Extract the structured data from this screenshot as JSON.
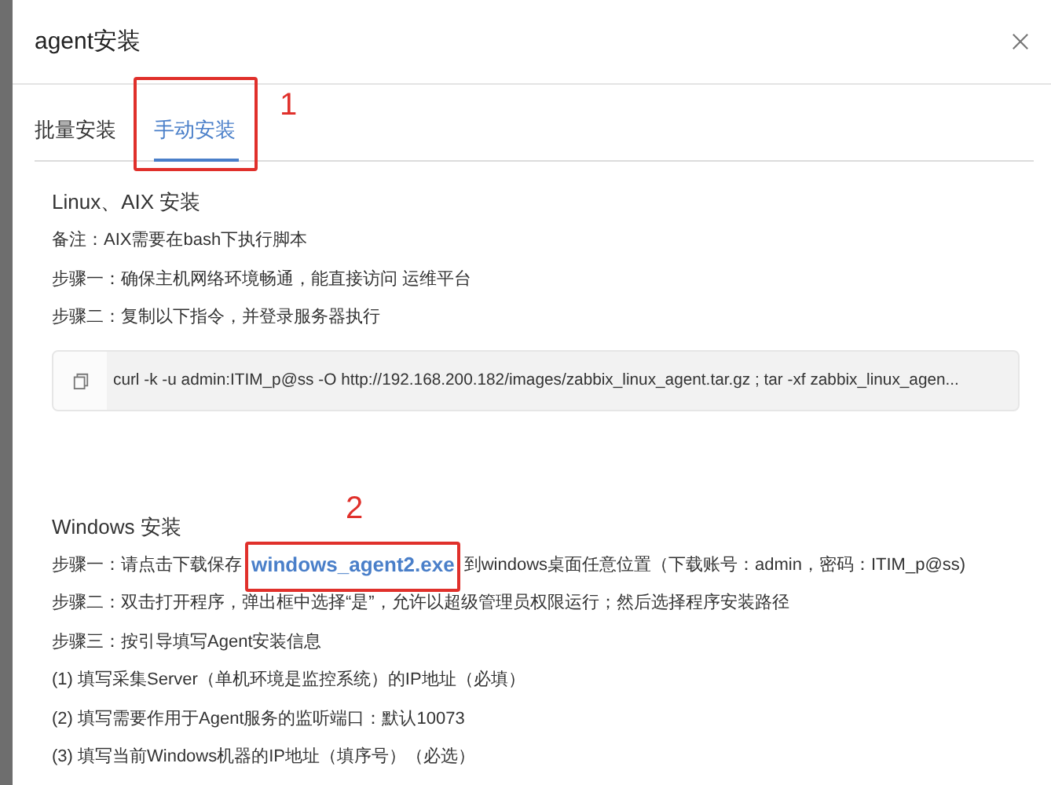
{
  "dialog": {
    "title": "agent安装"
  },
  "tabs": [
    {
      "label": "批量安装",
      "selected": false
    },
    {
      "label": "手动安装",
      "selected": true,
      "annotation": "1"
    }
  ],
  "sections": [
    {
      "heading": "Linux、AIX 安装",
      "lines": [
        {
          "kind": "text",
          "text": "备注：AIX需要在bash下执行脚本"
        },
        {
          "kind": "text",
          "text": "步骤一：确保主机网络环境畅通，能直接访问 运维平台"
        },
        {
          "kind": "text",
          "text": "步骤二：复制以下指令，并登录服务器执行"
        },
        {
          "kind": "command",
          "text": "curl -k -u admin:ITIM_p@ss -O http://192.168.200.182/images/zabbix_linux_agent.tar.gz ; tar -xf zabbix_linux_agen..."
        }
      ]
    },
    {
      "heading": "Windows 安装",
      "lines": [
        {
          "kind": "link",
          "before": "步骤一：请点击下载保存",
          "link": "windows_agent2.exe",
          "after": "到windows桌面任意位置（下载账号：admin，密码：ITIM_p@ss)",
          "annotation": "2"
        },
        {
          "kind": "text",
          "text": "步骤二：双击打开程序，弹出框中选择“是”，允许以超级管理员权限运行；然后选择程序安装路径"
        },
        {
          "kind": "text",
          "text": "步骤三：按引导填写Agent安装信息"
        },
        {
          "kind": "text",
          "text": "(1) 填写采集Server（单机环境是监控系统）的IP地址（必填）"
        },
        {
          "kind": "text",
          "text": "(2) 填写需要作用于Agent服务的监听端口：默认10073"
        },
        {
          "kind": "text",
          "text": "(3) 填写当前Windows机器的IP地址（填序号）（必选）"
        }
      ]
    }
  ]
}
